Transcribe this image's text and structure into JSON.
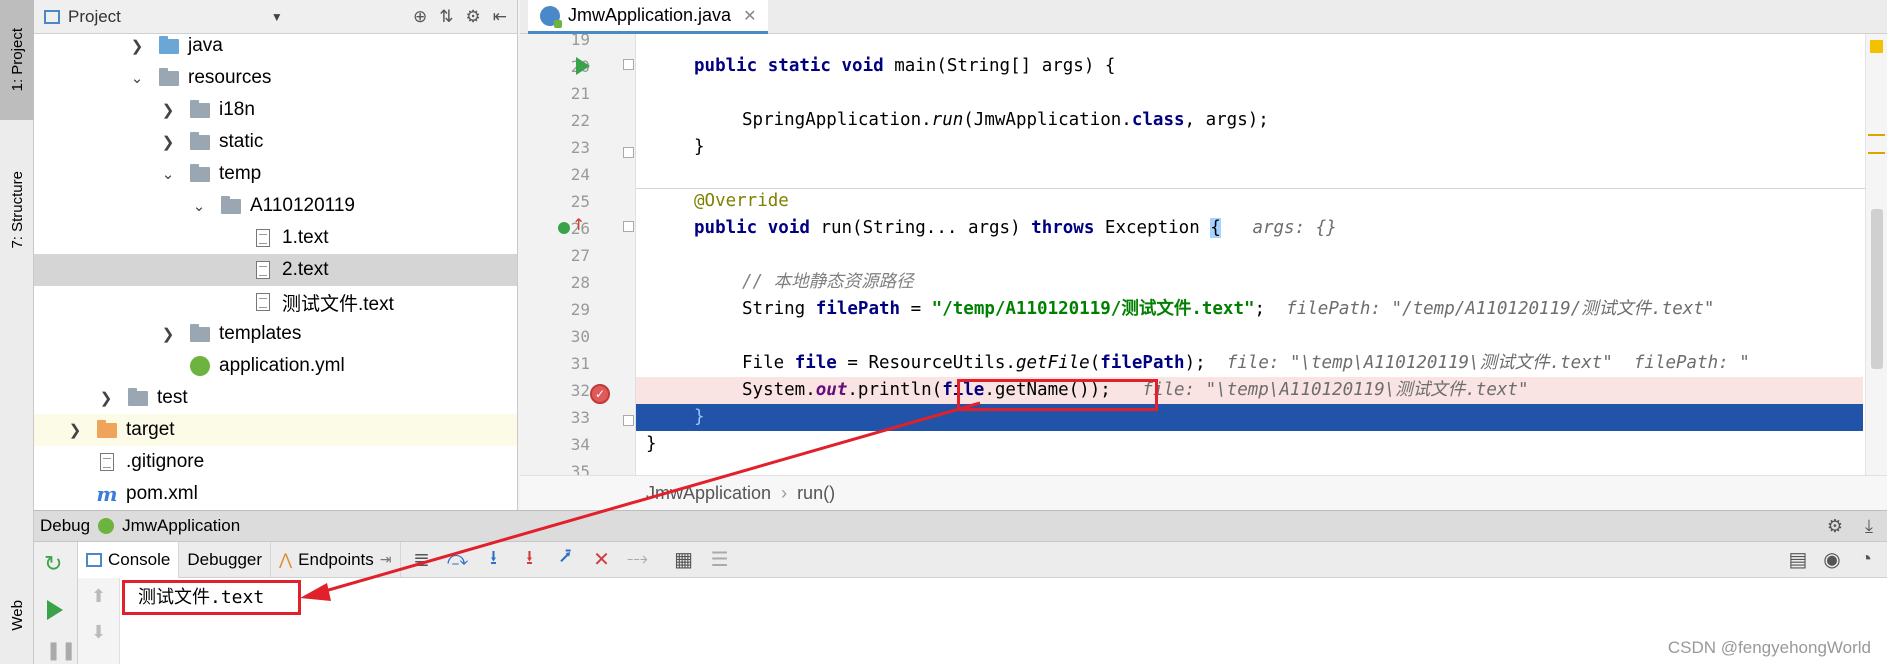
{
  "left_strip": {
    "project_tab": "1: Project",
    "structure_tab": "7: Structure",
    "web_tab": "Web"
  },
  "project": {
    "title": "Project",
    "tree": [
      {
        "label": "java",
        "icon": "folder-blue-icon",
        "expanded": false
      },
      {
        "label": "resources",
        "icon": "folder-icon",
        "expanded": true
      },
      {
        "label": "i18n",
        "icon": "folder-icon",
        "expanded": false
      },
      {
        "label": "static",
        "icon": "folder-icon",
        "expanded": false
      },
      {
        "label": "temp",
        "icon": "folder-icon",
        "expanded": true
      },
      {
        "label": "A110120119",
        "icon": "folder-icon",
        "expanded": true
      },
      {
        "label": "1.text",
        "icon": "file-icon"
      },
      {
        "label": "2.text",
        "icon": "file-icon",
        "selected": true
      },
      {
        "label": "测试文件.text",
        "icon": "file-icon"
      },
      {
        "label": "templates",
        "icon": "folder-icon",
        "expanded": false
      },
      {
        "label": "application.yml",
        "icon": "spring-yml-icon"
      },
      {
        "label": "test",
        "icon": "folder-icon",
        "expanded": false
      },
      {
        "label": "target",
        "icon": "folder-orange-icon",
        "expanded": false
      },
      {
        "label": ".gitignore",
        "icon": "file-icon"
      },
      {
        "label": "pom.xml",
        "icon": "maven-icon"
      }
    ]
  },
  "editor": {
    "tab_label": "JmwApplication.java",
    "line_numbers": [
      "19",
      "20",
      "21",
      "22",
      "23",
      "24",
      "25",
      "26",
      "27",
      "28",
      "29",
      "30",
      "31",
      "32",
      "33",
      "34",
      "35"
    ],
    "code": {
      "l20_a": "public static void ",
      "l20_b": "main(String[] args) {",
      "l22_a": "SpringApplication.",
      "l22_b": "run",
      "l22_c": "(JmwApplication.",
      "l22_d": "class",
      "l22_e": ", args);",
      "l23": "}",
      "l25": "@Override",
      "l26_a": "public void ",
      "l26_b": "run(String... args) ",
      "l26_c": "throws ",
      "l26_d": "Exception ",
      "l26_e": "{",
      "l26_hint": "args: {}",
      "l28": "// 本地静态资源路径",
      "l29_a": "String ",
      "l29_b": "filePath",
      "l29_c": " = ",
      "l29_d": "\"/temp/A110120119/测试文件.text\"",
      "l29_e": ";",
      "l29_hint": "filePath: \"/temp/A110120119/测试文件.text\"",
      "l31_a": "File ",
      "l31_b": "file",
      "l31_c": " = ResourceUtils.",
      "l31_d": "getFile",
      "l31_e": "(",
      "l31_f": "filePath",
      "l31_g": ");",
      "l31_hint": "file: \"\\temp\\A110120119\\测试文件.text\"  filePath: \"",
      "l32_a": "System.",
      "l32_b": "out",
      "l32_c": ".println(",
      "l32_d": "file",
      "l32_e": ".getName());",
      "l32_hint": "file: \"\\temp\\A110120119\\测试文件.text\"",
      "l33": "}",
      "l34": "}"
    },
    "breadcrumbs": [
      "JmwApplication",
      "run()"
    ]
  },
  "debug": {
    "title": "Debug",
    "config": "JmwApplication",
    "tabs": [
      "Console",
      "Debugger",
      "Endpoints"
    ],
    "console_output": "测试文件.text"
  },
  "watermark": "CSDN @fengyehongWorld",
  "colors": {
    "accent": "#4a88c7",
    "highlight_box": "#e0202a",
    "execution_line": "#2154a8",
    "breakpoint_line": "#fae3e3"
  }
}
